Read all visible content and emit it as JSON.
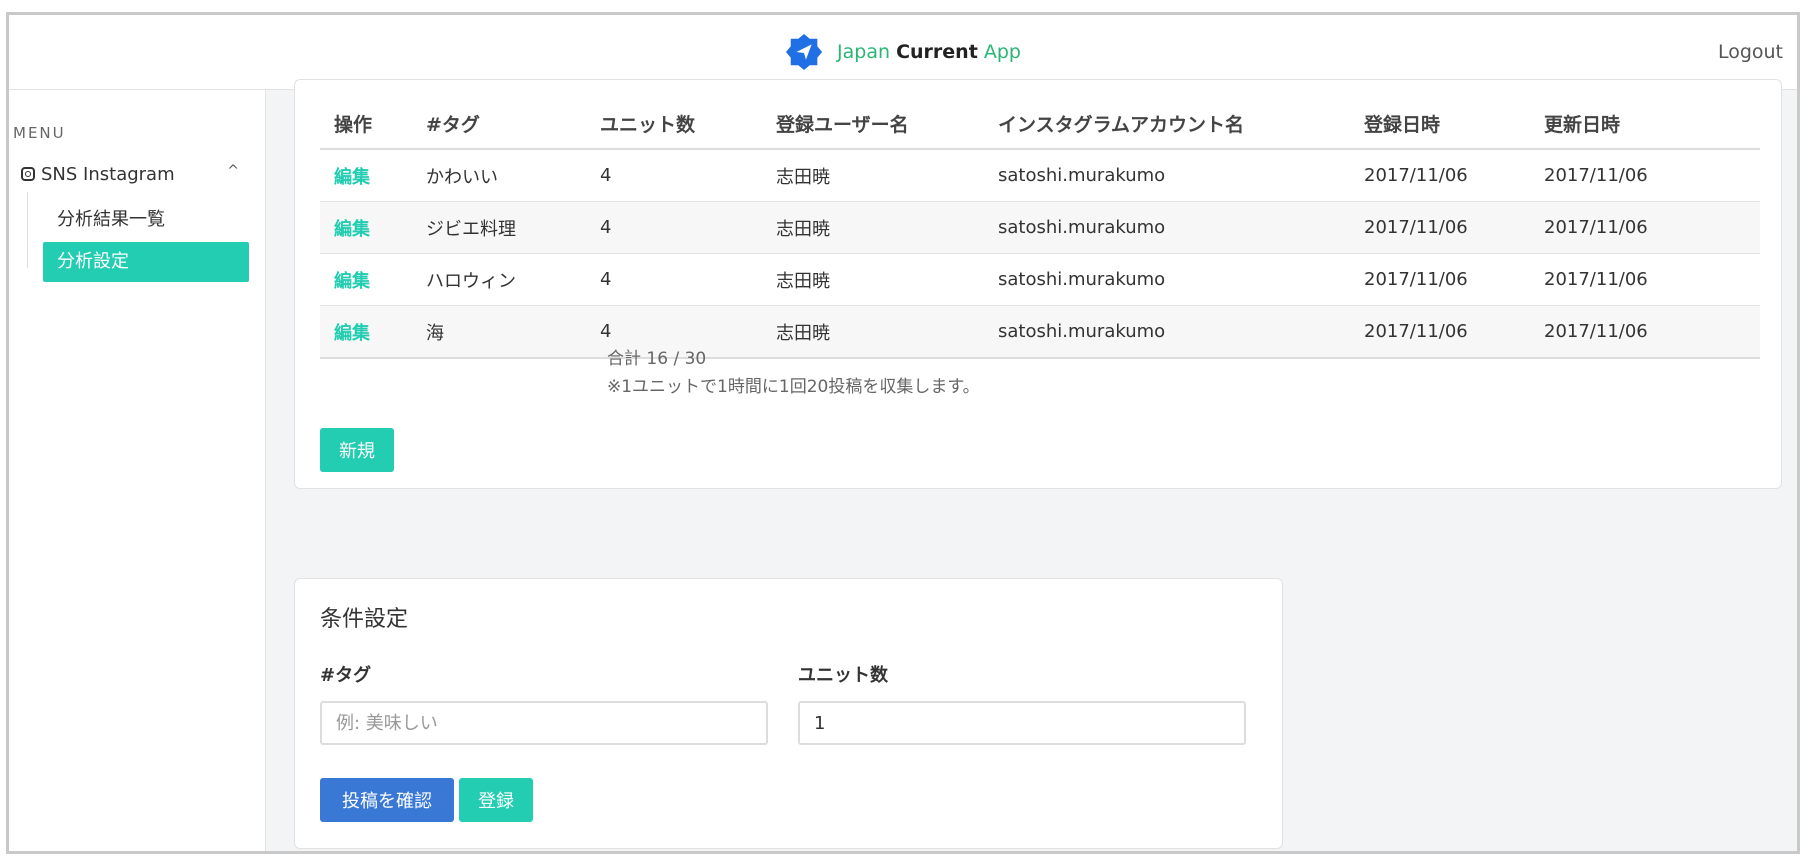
{
  "header": {
    "brand_japan": "Japan",
    "brand_current": "Current",
    "brand_app": "App",
    "logout": "Logout",
    "logo_icon": "send-icon",
    "brand_color": "#2bb673",
    "logo_color": "#1f6fe5"
  },
  "sidebar": {
    "menu_label": "MENU",
    "group": {
      "label": "SNS Instagram",
      "icon": "instagram-icon",
      "chevron": "^"
    },
    "items": [
      {
        "label": "分析結果一覧",
        "active": false
      },
      {
        "label": "分析設定",
        "active": true
      }
    ],
    "accent": "#22cdb1"
  },
  "table": {
    "headers": [
      "操作",
      "#タグ",
      "ユニット数",
      "登録ユーザー名",
      "インスタグラムアカウント名",
      "登録日時",
      "更新日時"
    ],
    "rows": [
      [
        "編集",
        "かわいい",
        "4",
        "志田暁",
        "satoshi.murakumo",
        "2017/11/06",
        "2017/11/06"
      ],
      [
        "編集",
        "ジビエ料理",
        "4",
        "志田暁",
        "satoshi.murakumo",
        "2017/11/06",
        "2017/11/06"
      ],
      [
        "編集",
        "ハロウィン",
        "4",
        "志田暁",
        "satoshi.murakumo",
        "2017/11/06",
        "2017/11/06"
      ],
      [
        "編集",
        "海",
        "4",
        "志田暁",
        "satoshi.murakumo",
        "2017/11/06",
        "2017/11/06"
      ]
    ],
    "total": "合計 16 / 30",
    "note": "※1ユニットで1時間に1回20投稿を収集します。",
    "new_button": "新規"
  },
  "conditions": {
    "title": "条件設定",
    "tag_label": "#タグ",
    "tag_placeholder": "例: 美味しい",
    "unit_label": "ユニット数",
    "unit_value": "1",
    "confirm_button": "投稿を確認",
    "register_button": "登録",
    "confirm_color": "#3a78d6"
  }
}
